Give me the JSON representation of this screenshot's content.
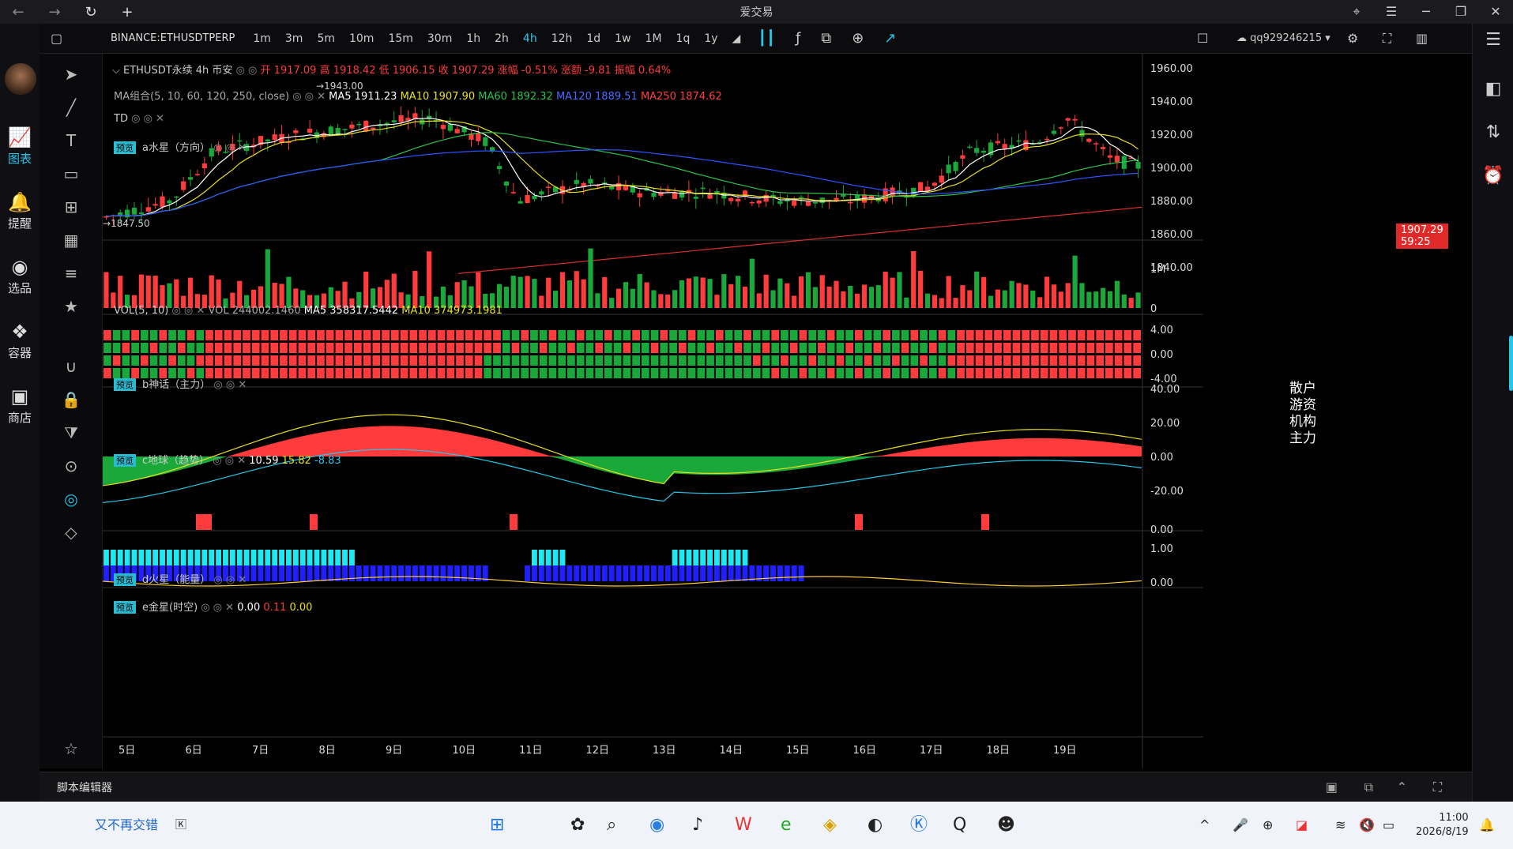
{
  "window": {
    "title": "爱交易",
    "controls": [
      "⌖",
      "☰",
      "─",
      "❐",
      "✕"
    ]
  },
  "left_nav": [
    {
      "label": "图表",
      "icon": "chart-icon"
    },
    {
      "label": "提醒",
      "icon": "bell-icon"
    },
    {
      "label": "选品",
      "icon": "pick-icon"
    },
    {
      "label": "容器",
      "icon": "container-icon"
    },
    {
      "label": "商店",
      "icon": "store-icon"
    }
  ],
  "toolbar": {
    "symbol": "BINANCE:ETHUSDTPERP",
    "timeframes": [
      "1m",
      "3m",
      "5m",
      "10m",
      "15m",
      "30m",
      "1h",
      "2h",
      "4h",
      "12h",
      "1d",
      "1w",
      "1M",
      "1q",
      "1y"
    ],
    "active_tf": "4h",
    "user": "qq929246215"
  },
  "colors": {
    "up": "#ff3b3b",
    "down": "#1aa83a",
    "accent": "#25c7e8",
    "ma5": "#ffffff",
    "ma10": "#e8e020",
    "ma60": "#2ec24a",
    "ma120": "#2d55ff",
    "ma250": "#d83030"
  },
  "main": {
    "header": "ETHUSDT永续 4h 币安",
    "ohlc": "开 1917.09 高 1918.42 低 1906.15 收 1907.29 涨幅 -0.51% 涨额 -9.81 振幅 0.64%",
    "ma_label": "MA组合(5, 10, 60, 120, 250, close)",
    "ma_values": {
      "ma5": "MA5 1911.23",
      "ma10": "MA10 1907.90",
      "ma60": "MA60 1892.32",
      "ma120": "MA120 1889.51",
      "ma250": "MA250 1874.62"
    },
    "td_label": "TD",
    "a_label": "a水星（方向）",
    "price_ticks": [
      "1960.00",
      "1940.00",
      "1920.00",
      "1900.00",
      "1880.00",
      "1860.00",
      "1840.00"
    ],
    "current_price": "1907.29",
    "countdown": "59:25",
    "low_mark": "1847.50",
    "high_mark": "1943.00"
  },
  "vol": {
    "label": "VOL(5, 10)",
    "vol": "VOL 244002.1460",
    "ma5": "MA5 358317.5442",
    "ma10": "MA10 374973.1981",
    "ticks": [
      "1M",
      "0"
    ]
  },
  "b_panel": {
    "label": "b神话（主力）",
    "rows": [
      "散户",
      "游资",
      "机构",
      "主力"
    ],
    "ticks": [
      "4.00",
      "0.00",
      "-4.00"
    ]
  },
  "c_panel": {
    "label": "c地球（趋势）",
    "v1": "10.59",
    "v2": "15.82",
    "v3": "-8.83",
    "ticks": [
      "40.00",
      "20.00",
      "0.00",
      "-20.00"
    ]
  },
  "d_panel": {
    "label": "d火星（能量）",
    "ticks": [
      "0.00"
    ]
  },
  "e_panel": {
    "label": "e金星(时空)",
    "v1": "0.00",
    "v2": "0.11",
    "v3": "0.00",
    "ticks": [
      "1.00",
      "0.00"
    ]
  },
  "x_axis": [
    "5日",
    "6日",
    "7日",
    "8日",
    "9日",
    "10日",
    "11日",
    "12日",
    "13日",
    "14日",
    "15日",
    "16日",
    "17日",
    "18日",
    "19日"
  ],
  "badge": "预览",
  "script_editor": "脚本编辑器",
  "taskbar": {
    "left_text": "又不再交错",
    "time": "11:00",
    "date": "2026/8/19"
  }
}
